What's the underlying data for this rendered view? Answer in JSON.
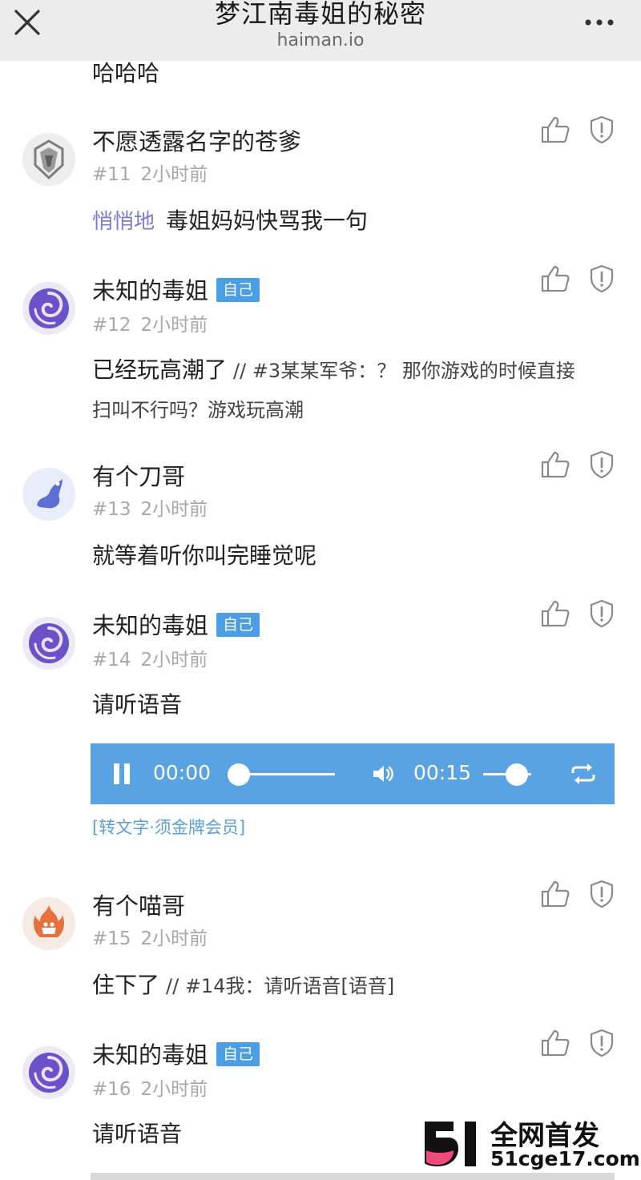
{
  "header": {
    "title": "梦江南毒姐的秘密",
    "domain": "haiman.io"
  },
  "prev_comment_tail": "哈哈哈",
  "comments": [
    {
      "username": "不愿透露名字的苍爹",
      "self_badge": "",
      "floor": "#11",
      "time": "2小时前",
      "whisper_label": "悄悄地",
      "text": "毒姐妈妈快骂我一句",
      "avatar_color": "#8a8a8a"
    },
    {
      "username": "未知的毒姐",
      "self_badge": "自己",
      "floor": "#12",
      "time": "2小时前",
      "text": "已经玩高潮了",
      "quote": "// #3某某军爷：？ 那你游戏的时候直接",
      "text_line2": "扫叫不行吗？游戏玩高潮",
      "avatar_color": "#6a52c9"
    },
    {
      "username": "有个刀哥",
      "self_badge": "",
      "floor": "#13",
      "time": "2小时前",
      "text": "就等着听你叫完睡觉呢",
      "avatar_color": "#5b6fd6"
    },
    {
      "username": "未知的毒姐",
      "self_badge": "自己",
      "floor": "#14",
      "time": "2小时前",
      "text": "请听语音",
      "avatar_color": "#6a52c9",
      "audio": {
        "current_time": "00:00",
        "duration": "00:15",
        "progress": 0,
        "volume": 0.7
      },
      "transcribe_label": "[转文字·须金牌会员]"
    },
    {
      "username": "有个喵哥",
      "self_badge": "",
      "floor": "#15",
      "time": "2小时前",
      "text": "住下了",
      "quote": "// #14我：请听语音[语音]",
      "avatar_color": "#e8703a"
    },
    {
      "username": "未知的毒姐",
      "self_badge": "自己",
      "floor": "#16",
      "time": "2小时前",
      "text": "请听语音",
      "avatar_color": "#6a52c9"
    }
  ],
  "watermark": {
    "title": "全网首发",
    "site": "51cge17.com",
    "logo_text": "51",
    "accent": "#f04a7a"
  },
  "colors": {
    "badge_blue": "#4a9ee6",
    "audio_blue": "#5aa3e2",
    "whisper_purple": "#7b7ad8",
    "meta_gray": "#a8a8a8"
  },
  "icons": [
    "close-icon",
    "more-icon",
    "thumb-up-icon",
    "shield-icon",
    "pause-icon",
    "volume-icon",
    "loop-icon"
  ]
}
